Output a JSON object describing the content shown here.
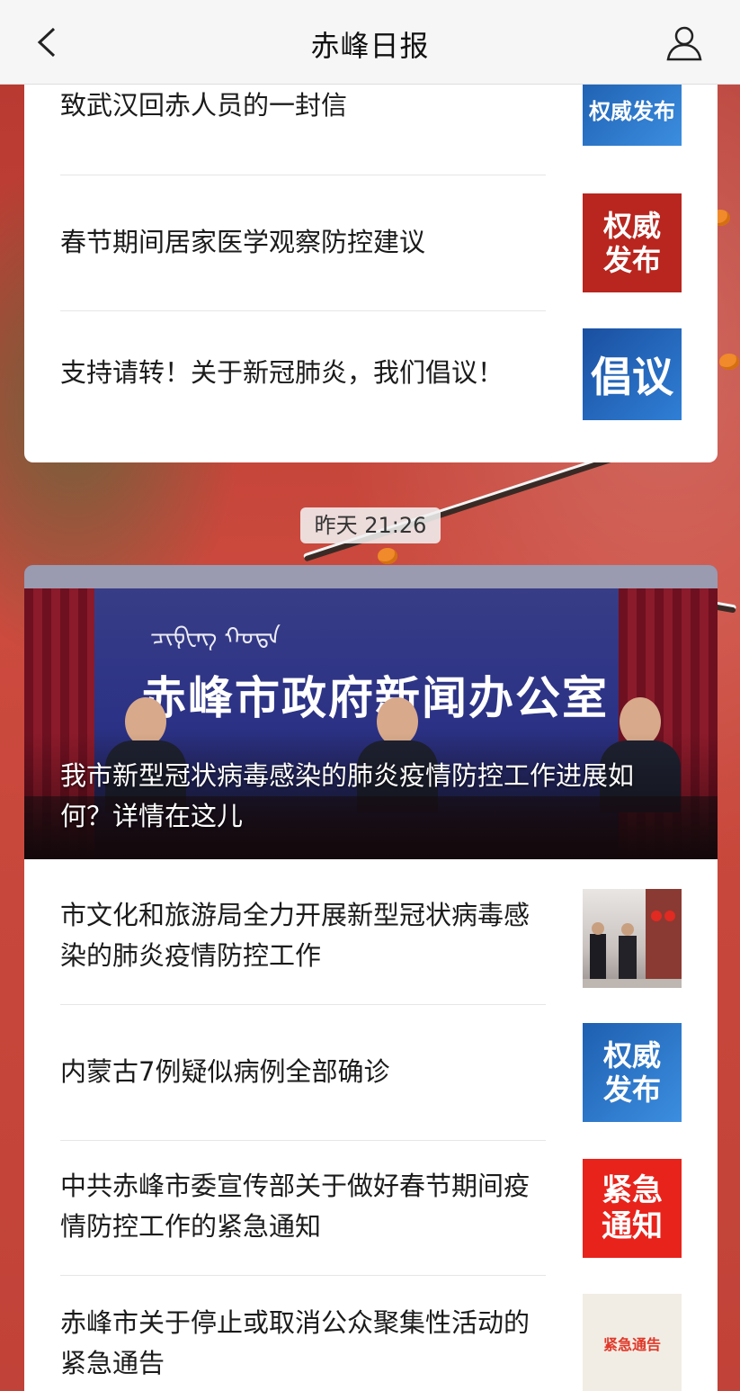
{
  "header": {
    "title": "赤峰日报"
  },
  "card1": {
    "items": [
      {
        "title": "致武汉回赤人员的一封信",
        "thumb_text": "权威发布"
      },
      {
        "title": "春节期间居家医学观察防控建议",
        "thumb_text": "权威发布"
      },
      {
        "title": "支持请转！关于新冠肺炎，我们倡议！",
        "thumb_text": "倡议"
      }
    ]
  },
  "timestamp": "昨天 21:26",
  "card2": {
    "hero": {
      "sign_text": "赤峰市政府新闻办公室",
      "caption": "我市新型冠状病毒感染的肺炎疫情防控工作进展如何？详情在这儿"
    },
    "items": [
      {
        "title": "市文化和旅游局全力开展新型冠状病毒感染的肺炎疫情防控工作",
        "thumb_text": ""
      },
      {
        "title": "内蒙古7例疑似病例全部确诊",
        "thumb_text": "权威发布"
      },
      {
        "title": "中共赤峰市委宣传部关于做好春节期间疫情防控工作的紧急通知",
        "thumb_text": "紧急通知"
      },
      {
        "title": "赤峰市关于停止或取消公众聚集性活动的紧急通告",
        "thumb_text": "紧急通告"
      }
    ]
  },
  "colors": {
    "background_red": "#c8443a",
    "header_bg": "#f6f6f6",
    "card_bg": "#ffffff"
  }
}
